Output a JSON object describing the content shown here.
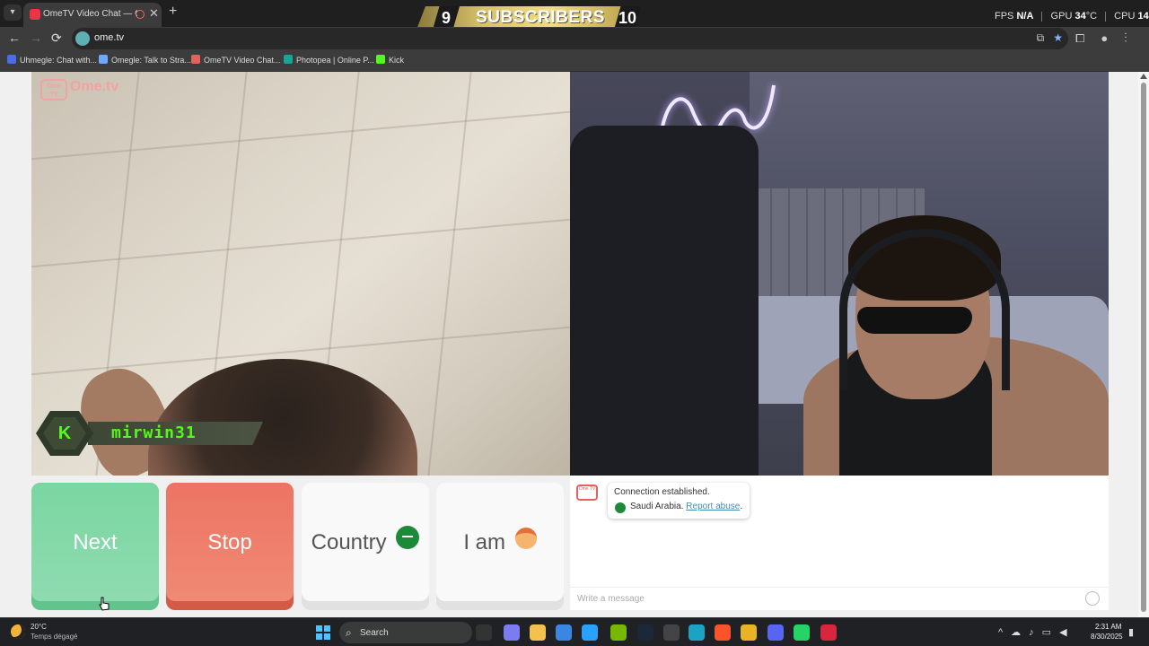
{
  "browser": {
    "tab_title": "OmeTV Video Chat — Ome...",
    "close_glyph": "✕",
    "new_tab_glyph": "+",
    "url": "ome.tv",
    "back_glyph": "←",
    "forward_glyph": "→",
    "reload_glyph": "⟳",
    "bookmarks": [
      {
        "label": "Uhmegle: Chat with...",
        "color": "#4a6de5"
      },
      {
        "label": "Omegle: Talk to Stra...",
        "color": "#6ea8ff"
      },
      {
        "label": "OmeTV Video Chat...",
        "color": "#e4625e"
      },
      {
        "label": "Photopea | Online P...",
        "color": "#18a497"
      },
      {
        "label": "Kick",
        "color": "#53fc18"
      }
    ]
  },
  "overlay": {
    "subs_current": "9",
    "subs_label": "SUBSCRIBERS",
    "subs_goal": "10",
    "fps_label": "FPS",
    "fps_value": "N/A",
    "gpu_label": "GPU",
    "gpu_value": "34",
    "gpu_unit": "°C",
    "cpu_label": "CPU",
    "cpu_value": "14",
    "cpu_unit": "%",
    "kick_letter": "K",
    "kick_username": "mirwin31"
  },
  "app": {
    "logo_text": "Ome.tv",
    "logo_box_text": "Ome TV",
    "buttons": {
      "next": "Next",
      "stop": "Stop",
      "country": "Country",
      "iam": "I am"
    },
    "chat": {
      "status": "Connection established.",
      "country": "Saudi Arabia.",
      "report_link": "Report abuse",
      "report_suffix": ".",
      "placeholder": "Write a message"
    }
  },
  "taskbar": {
    "weather_temp": "20°C",
    "weather_desc": "Temps dégagé",
    "search_label": "Search",
    "time": "2:31 AM",
    "date": "8/30/2025",
    "apps": [
      {
        "name": "explorer",
        "color": "#333"
      },
      {
        "name": "copilot",
        "color": "#7a7cf0"
      },
      {
        "name": "files",
        "color": "#f2c14e"
      },
      {
        "name": "store",
        "color": "#3a86e0"
      },
      {
        "name": "calculator",
        "color": "#2aa0ff"
      },
      {
        "name": "nvidia",
        "color": "#76b900"
      },
      {
        "name": "steam",
        "color": "#1b2838"
      },
      {
        "name": "obs",
        "color": "#444"
      },
      {
        "name": "edge",
        "color": "#1ca3c4"
      },
      {
        "name": "brave",
        "color": "#fb542b"
      },
      {
        "name": "chrome",
        "color": "#e9b424"
      },
      {
        "name": "discord",
        "color": "#5865f2"
      },
      {
        "name": "whatsapp",
        "color": "#25d366"
      },
      {
        "name": "capcut",
        "color": "#d7263d"
      }
    ]
  }
}
